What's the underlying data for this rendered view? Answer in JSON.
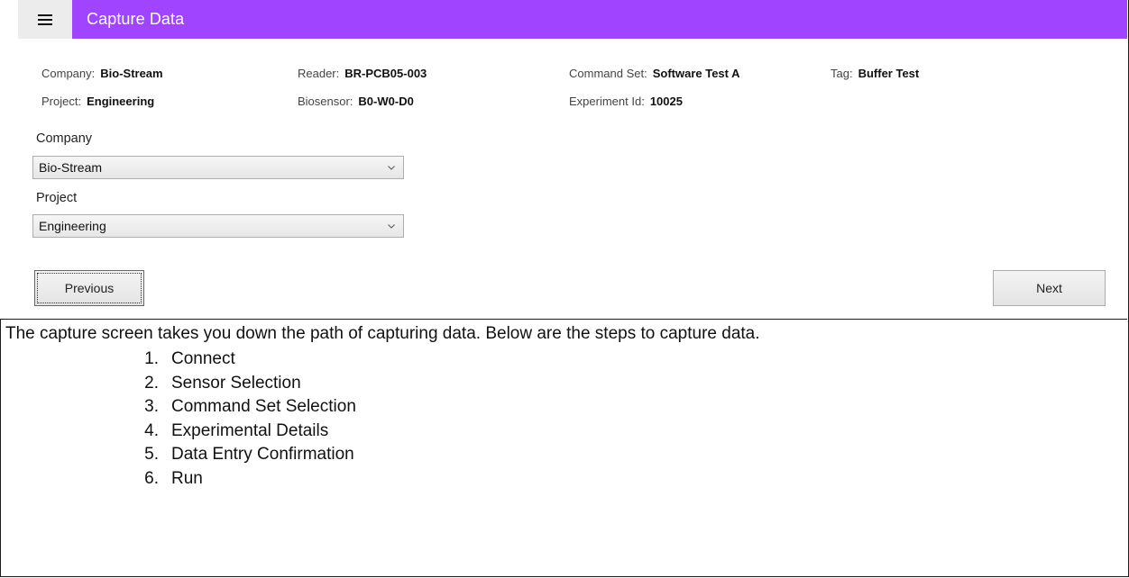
{
  "app": {
    "title": "Capture Data",
    "menu_icon": "hamburger-icon",
    "accent_color": "#a044ff"
  },
  "summary": {
    "company": {
      "label": "Company:",
      "value": "Bio-Stream"
    },
    "reader": {
      "label": "Reader:",
      "value": "BR-PCB05-003"
    },
    "command_set": {
      "label": "Command Set:",
      "value": "Software Test A"
    },
    "tag": {
      "label": "Tag:",
      "value": "Buffer Test"
    },
    "project": {
      "label": "Project:",
      "value": "Engineering"
    },
    "biosensor": {
      "label": "Biosensor:",
      "value": "B0-W0-D0"
    },
    "experiment_id": {
      "label": "Experiment Id:",
      "value": "10025"
    }
  },
  "form": {
    "company": {
      "label": "Company",
      "selected": "Bio-Stream"
    },
    "project": {
      "label": "Project",
      "selected": "Engineering"
    }
  },
  "buttons": {
    "previous": "Previous",
    "next": "Next"
  },
  "doc": {
    "intro": "The capture screen takes you down the path of capturing data.  Below are the steps to capture data.",
    "steps": [
      {
        "num": "1.",
        "text": "Connect"
      },
      {
        "num": "2.",
        "text": "Sensor Selection"
      },
      {
        "num": "3.",
        "text": "Command Set Selection"
      },
      {
        "num": "4.",
        "text": "Experimental Details"
      },
      {
        "num": "5.",
        "text": "Data Entry Confirmation"
      },
      {
        "num": "6.",
        "text": "Run"
      }
    ]
  }
}
